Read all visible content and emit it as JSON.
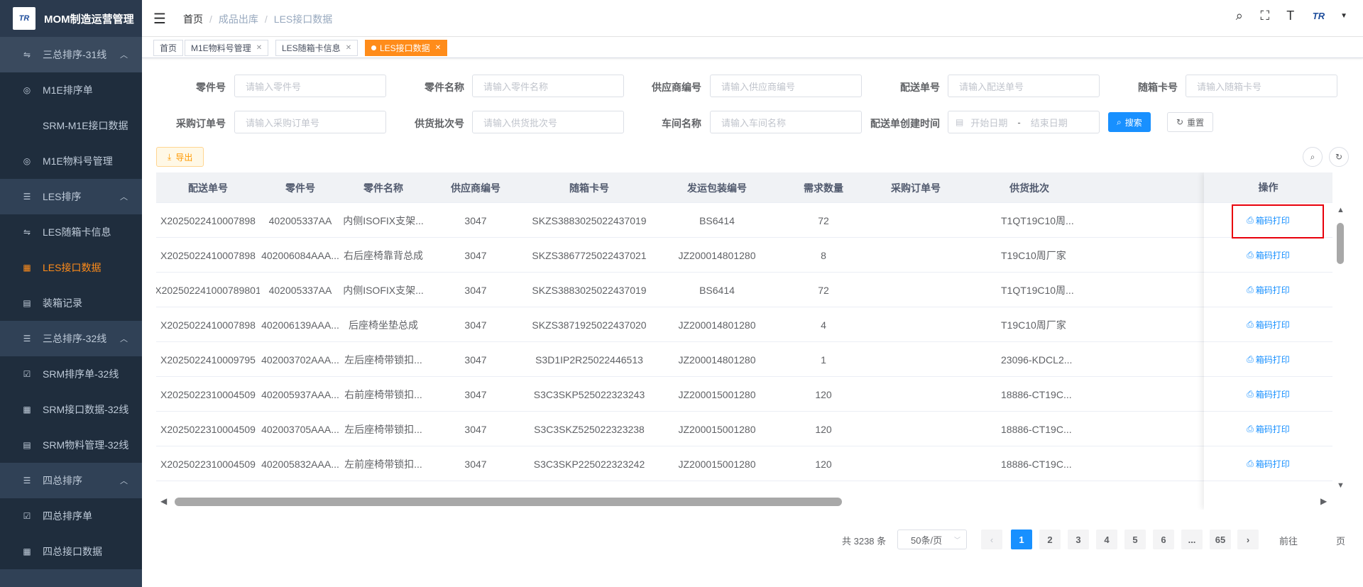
{
  "app": {
    "logo_text": "TR",
    "title": "MOM制造运营管理"
  },
  "sidebar": {
    "items": [
      {
        "label": "三总排序-31线",
        "icon": "sort-icon",
        "glyph": "⇋",
        "kind": "group1",
        "chevron": "︿"
      },
      {
        "label": "M1E排序单",
        "icon": "pin-icon",
        "glyph": "◎",
        "kind": "sub"
      },
      {
        "label": "SRM-M1E接口数据",
        "icon": "",
        "glyph": "",
        "kind": "sub"
      },
      {
        "label": "M1E物料号管理",
        "icon": "pin-icon",
        "glyph": "◎",
        "kind": "sub"
      },
      {
        "label": "LES排序",
        "icon": "list-icon",
        "glyph": "☰",
        "kind": "parent",
        "chevron": "︿"
      },
      {
        "label": "LES随箱卡信息",
        "icon": "sort-icon",
        "glyph": "⇋",
        "kind": "sub"
      },
      {
        "label": "LES接口数据",
        "icon": "grid-icon",
        "glyph": "▦",
        "kind": "sub",
        "active": true
      },
      {
        "label": "装箱记录",
        "icon": "box-icon",
        "glyph": "▤",
        "kind": "sub"
      },
      {
        "label": "三总排序-32线",
        "icon": "list-icon",
        "glyph": "☰",
        "kind": "parent",
        "chevron": "︿"
      },
      {
        "label": "SRM排序单-32线",
        "icon": "check-icon",
        "glyph": "☑",
        "kind": "sub"
      },
      {
        "label": "SRM接口数据-32线",
        "icon": "grid-icon",
        "glyph": "▦",
        "kind": "sub"
      },
      {
        "label": "SRM物料管理-32线",
        "icon": "calendar-icon",
        "glyph": "▤",
        "kind": "sub"
      },
      {
        "label": "四总排序",
        "icon": "list-icon",
        "glyph": "☰",
        "kind": "parent",
        "chevron": "︿"
      },
      {
        "label": "四总排序单",
        "icon": "check-icon",
        "glyph": "☑",
        "kind": "sub"
      },
      {
        "label": "四总接口数据",
        "icon": "grid-icon",
        "glyph": "▦",
        "kind": "sub"
      }
    ]
  },
  "header": {
    "breadcrumb": [
      "首页",
      "成品出库",
      "LES接口数据"
    ],
    "right_logo": "TR"
  },
  "tags": [
    {
      "label": "首页",
      "closable": false
    },
    {
      "label": "M1E物料号管理",
      "closable": true
    },
    {
      "label": "LES随箱卡信息",
      "closable": true
    },
    {
      "label": "LES接口数据",
      "closable": true,
      "active": true
    }
  ],
  "filters": {
    "part_no": {
      "label": "零件号",
      "placeholder": "请输入零件号"
    },
    "part_name": {
      "label": "零件名称",
      "placeholder": "请输入零件名称"
    },
    "supplier_code": {
      "label": "供应商编号",
      "placeholder": "请输入供应商编号"
    },
    "delivery_no": {
      "label": "配送单号",
      "placeholder": "请输入配送单号"
    },
    "card_no": {
      "label": "随箱卡号",
      "placeholder": "请输入随箱卡号"
    },
    "po_no": {
      "label": "采购订单号",
      "placeholder": "请输入采购订单号"
    },
    "batch_no": {
      "label": "供货批次号",
      "placeholder": "请输入供货批次号"
    },
    "workshop": {
      "label": "车间名称",
      "placeholder": "请输入车间名称"
    },
    "created_time": {
      "label": "配送单创建时间",
      "start": "开始日期",
      "sep": "-",
      "end": "结束日期"
    },
    "search_label": "搜索",
    "reset_label": "重置",
    "export_label": "导出"
  },
  "table": {
    "columns": [
      "配送单号",
      "零件号",
      "零件名称",
      "供应商编号",
      "随箱卡号",
      "发运包装编号",
      "需求数量",
      "采购订单号",
      "供货批次"
    ],
    "action_column": "操作",
    "action_label": "箱码打印",
    "rows": [
      [
        "X2025022410007898",
        "402005337AA",
        "内侧ISOFIX支架...",
        "3047",
        "SKZS3883025022437019",
        "BS6414",
        "72",
        "",
        "T1QT19C10周..."
      ],
      [
        "X2025022410007898",
        "402006084AAA...",
        "右后座椅靠背总成",
        "3047",
        "SKZS3867725022437021",
        "JZ200014801280",
        "8",
        "",
        "T19C10周厂家"
      ],
      [
        "X202502241000789801",
        "402005337AA",
        "内侧ISOFIX支架...",
        "3047",
        "SKZS3883025022437019",
        "BS6414",
        "72",
        "",
        "T1QT19C10周..."
      ],
      [
        "X2025022410007898",
        "402006139AAA...",
        "后座椅坐垫总成",
        "3047",
        "SKZS3871925022437020",
        "JZ200014801280",
        "4",
        "",
        "T19C10周厂家"
      ],
      [
        "X2025022410009795",
        "402003702AAA...",
        "左后座椅带锁扣...",
        "3047",
        "S3D1IP2R25022446513",
        "JZ200014801280",
        "1",
        "",
        "23096-KDCL2..."
      ],
      [
        "X2025022310004509",
        "402005937AAA...",
        "右前座椅带锁扣...",
        "3047",
        "S3C3SKP525022323243",
        "JZ200015001280",
        "120",
        "",
        "18886-CT19C..."
      ],
      [
        "X2025022310004509",
        "402003705AAA...",
        "左后座椅带锁扣...",
        "3047",
        "S3C3SKZ525022323238",
        "JZ200015001280",
        "120",
        "",
        "18886-CT19C..."
      ],
      [
        "X2025022310004509",
        "402005832AAA...",
        "左前座椅带锁扣...",
        "3047",
        "S3C3SKP225022323242",
        "JZ200015001280",
        "120",
        "",
        "18886-CT19C..."
      ]
    ]
  },
  "pagination": {
    "total": "共 3238 条",
    "page_size": "50条/页",
    "pages": [
      "1",
      "2",
      "3",
      "4",
      "5",
      "6",
      "...",
      "65"
    ],
    "current": "1",
    "goto_label": "前往",
    "page_suffix": "页"
  }
}
